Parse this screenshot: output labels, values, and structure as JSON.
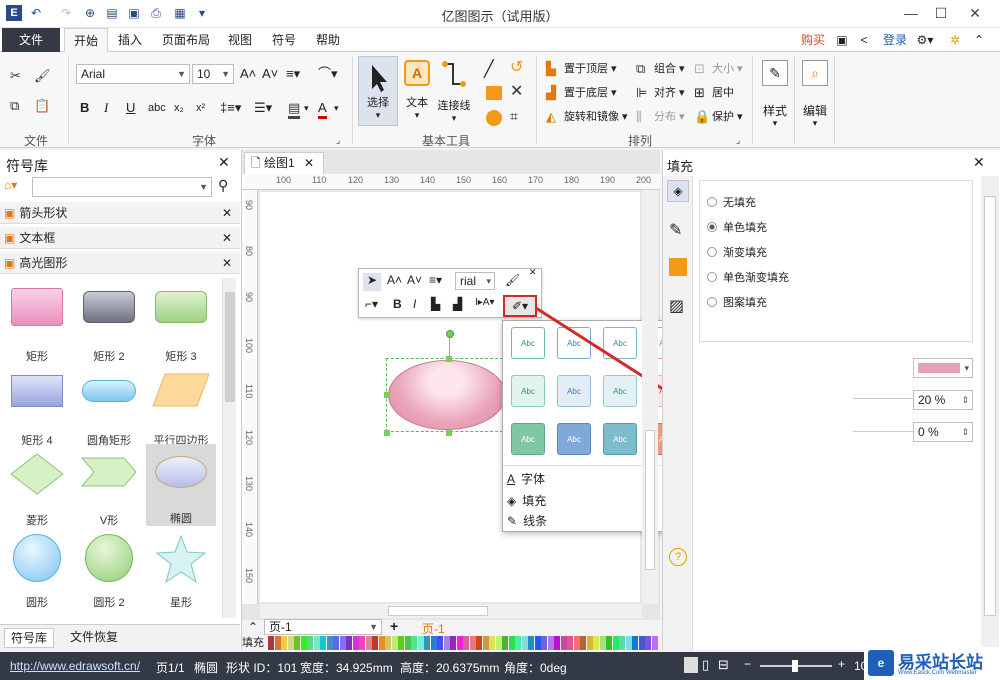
{
  "window": {
    "title": "亿图图示（试用版）",
    "min": "—",
    "max": "☐",
    "close": "✕"
  },
  "tabs": {
    "file": "文件",
    "items": [
      "开始",
      "插入",
      "页面布局",
      "视图",
      "符号",
      "帮助"
    ]
  },
  "top_right": {
    "buy": "购买",
    "login": "登录"
  },
  "ribbon": {
    "groups": {
      "file": "文件",
      "font": "字体",
      "basic": "基本工具",
      "arrange": "排列"
    },
    "font_name": "Arial",
    "font_size": "10",
    "tools": {
      "select": "选择",
      "text": "文本",
      "connector": "连接线"
    },
    "arrange": {
      "bring_top": "置于顶层",
      "send_bottom": "置于底层",
      "rotate": "旋转和镜像",
      "group": "组合",
      "size": "大小",
      "align": "对齐",
      "center": "居中",
      "distribute": "分布",
      "protect": "保护"
    },
    "style": "样式",
    "edit": "编辑"
  },
  "library": {
    "title": "符号库",
    "search_placeholder": "",
    "categories": [
      "箭头形状",
      "文本框",
      "高光图形"
    ],
    "shapes": [
      "矩形",
      "矩形 2",
      "矩形 3",
      "矩形 4",
      "圆角矩形",
      "平行四边形",
      "菱形",
      "V形",
      "椭圆",
      "圆形",
      "圆形 2",
      "星形"
    ],
    "bottom_tabs": [
      "符号库",
      "文件恢复"
    ]
  },
  "doc": {
    "tab": "绘图1",
    "page_name": "页-1",
    "page_tab": "页-1",
    "fill_label": "填充",
    "ruler_h": [
      "100",
      "110",
      "120",
      "130",
      "140",
      "150",
      "160",
      "170",
      "180",
      "190",
      "200"
    ],
    "ruler_v": [
      "90",
      "80",
      "90",
      "100",
      "110",
      "120",
      "130",
      "140",
      "150"
    ]
  },
  "mini_toolbar": {
    "font": "rial"
  },
  "style_popup": {
    "swatch_text": "Abc",
    "menu": [
      "字体",
      "填充",
      "线条"
    ]
  },
  "fill_panel": {
    "title": "填充",
    "options": [
      "无填充",
      "单色填充",
      "渐变填充",
      "单色渐变填充",
      "图案填充"
    ],
    "selected": 1,
    "color": "#e8a0b4",
    "transparency": "20 %",
    "brightness": "0 %"
  },
  "status": {
    "url": "http://www.edrawsoft.cn/",
    "page": "页1/1",
    "shape": "椭圆",
    "shape_id": "形状 ID：101",
    "width": "宽度：34.925mm",
    "height": "高度：20.6375mm",
    "angle": "角度：0deg",
    "zoom": "10"
  },
  "watermark": {
    "name": "易采站长站",
    "sub": "Www.Easck.Com Webmaster"
  }
}
